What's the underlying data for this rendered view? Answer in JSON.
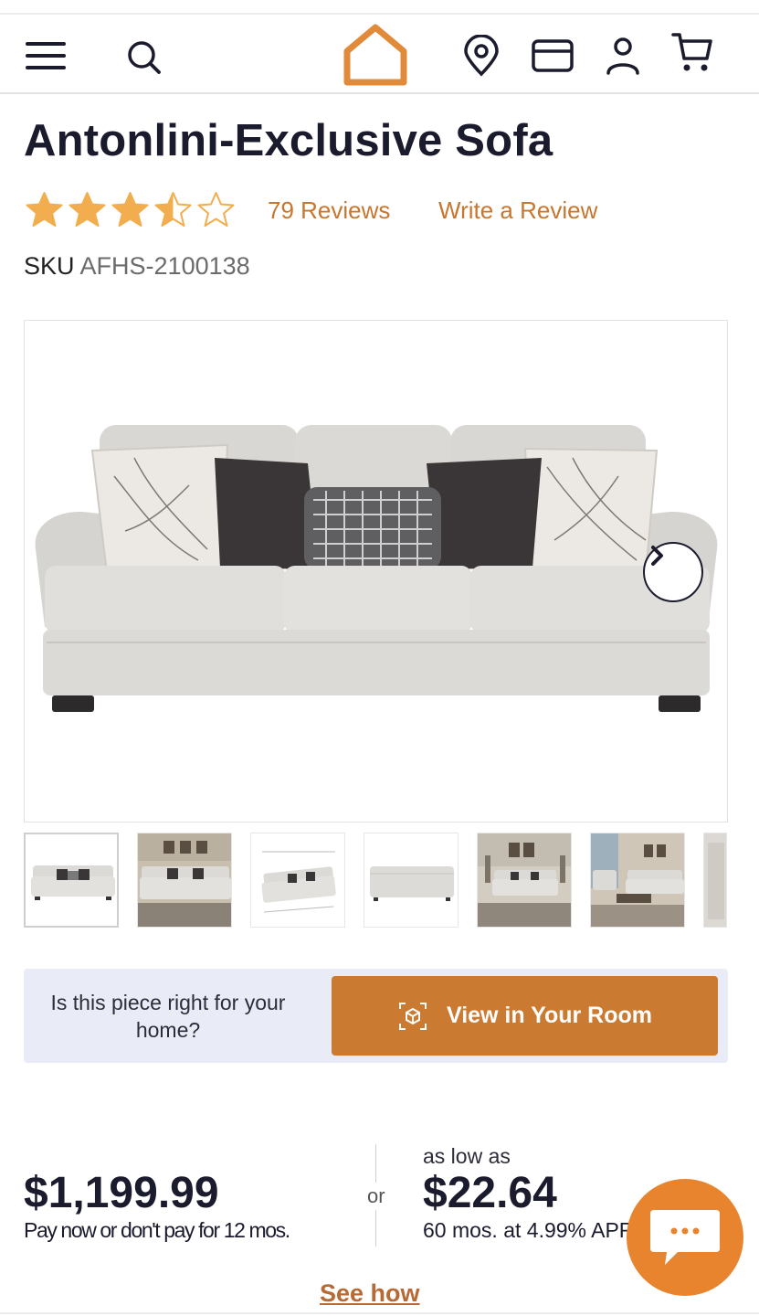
{
  "header": {
    "menu_icon": "hamburger-menu-icon",
    "search_icon": "search-icon",
    "logo_icon": "home-logo-icon",
    "location_icon": "location-pin-icon",
    "card_icon": "credit-card-icon",
    "account_icon": "user-icon",
    "cart_icon": "cart-icon"
  },
  "product": {
    "title": "Antonlini-Exclusive Sofa",
    "rating": 3.5,
    "rating_max": 5,
    "reviews_label": "79 Reviews",
    "write_review_label": "Write a Review",
    "sku_label": "SKU",
    "sku_value": "AFHS-2100138"
  },
  "gallery": {
    "next_icon": "chevron-right-icon",
    "thumbnail_count": 7
  },
  "room": {
    "question": "Is this piece right for your home?",
    "button_label": "View in Your Room",
    "button_icon": "ar-cube-icon"
  },
  "pricing": {
    "price": "$1,199.99",
    "pay_note": "Pay now or don't pay for 12 mos.",
    "or_label": "or",
    "as_low_as": "as low as",
    "monthly": "$22.64",
    "terms": "60 mos. at 4.99% APR",
    "see_how": "See how"
  },
  "chat": {
    "icon": "chat-bubble-icon"
  },
  "colors": {
    "accent": "#c8762f",
    "button": "#cb7b31",
    "chat": "#e8832e",
    "text_dark": "#1b1b2e"
  }
}
